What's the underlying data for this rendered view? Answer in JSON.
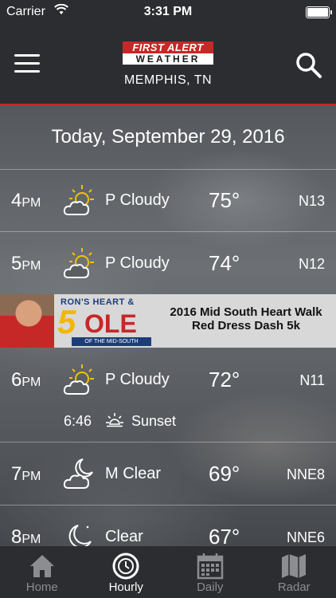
{
  "status_bar": {
    "carrier": "Carrier",
    "time": "3:31 PM"
  },
  "header": {
    "logo_line1": "FIRST ALERT",
    "logo_line2": "WEATHER",
    "location": "MEMPHIS, TN"
  },
  "date_label": "Today, September 29, 2016",
  "hours": [
    {
      "hour": "4",
      "ampm": "PM",
      "icon": "partly-cloudy-day-icon",
      "condition": "P Cloudy",
      "temp": "75°",
      "wind": "N13"
    },
    {
      "hour": "5",
      "ampm": "PM",
      "icon": "partly-cloudy-day-icon",
      "condition": "P Cloudy",
      "temp": "74°",
      "wind": "N12"
    },
    {
      "hour": "6",
      "ampm": "PM",
      "icon": "partly-cloudy-day-icon",
      "condition": "P Cloudy",
      "temp": "72°",
      "wind": "N11",
      "sunset": {
        "time": "6:46",
        "label": "Sunset"
      }
    },
    {
      "hour": "7",
      "ampm": "PM",
      "icon": "mostly-clear-night-icon",
      "condition": "M Clear",
      "temp": "69°",
      "wind": "NNE8"
    },
    {
      "hour": "8",
      "ampm": "PM",
      "icon": "clear-night-icon",
      "condition": "Clear",
      "temp": "67°",
      "wind": "NNE6"
    }
  ],
  "ad": {
    "brand_top": "RON'S HEART &",
    "brand_five": "5",
    "brand_ole": "OLE",
    "brand_sub": "OF THE MID-SOUTH",
    "line1": "2016 Mid South Heart Walk",
    "line2": "Red Dress Dash 5k"
  },
  "tabs": [
    {
      "label": "Home",
      "icon": "home-icon",
      "active": false
    },
    {
      "label": "Hourly",
      "icon": "clock-icon",
      "active": true
    },
    {
      "label": "Daily",
      "icon": "calendar-icon",
      "active": false
    },
    {
      "label": "Radar",
      "icon": "map-icon",
      "active": false
    }
  ],
  "colors": {
    "accent": "#c62828",
    "bar_bg": "#2b2d30",
    "inactive_tab": "#8b8d90"
  }
}
